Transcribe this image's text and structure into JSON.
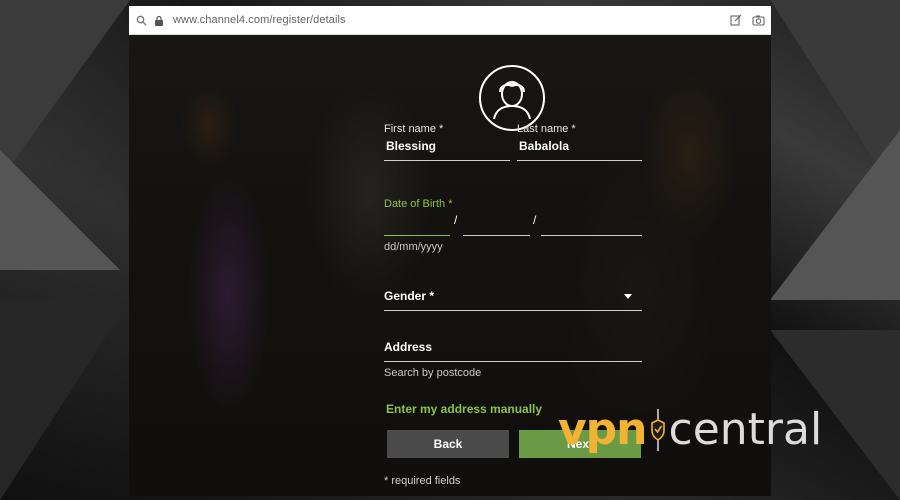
{
  "browser": {
    "url": "www.channel4.com/register/details"
  },
  "form": {
    "first_name_label": "First name *",
    "first_name_value": "Blessing",
    "last_name_label": "Last name *",
    "last_name_value": "Babalola",
    "dob_label": "Date of Birth *",
    "dob_separator": "/",
    "dob_hint": "dd/mm/yyyy",
    "gender_label": "Gender *",
    "address_label": "Address",
    "address_hint": "Search by postcode",
    "manual_address_link": "Enter my address manually",
    "back_button": "Back",
    "next_button": "Next",
    "required_note": "* required fields"
  },
  "watermark": {
    "brand_left": "vpn",
    "brand_right": "central"
  },
  "colors": {
    "accent_green": "#8bc34a",
    "button_green": "#6a9a46",
    "watermark_orange": "#f2b233"
  },
  "icons": [
    "search-icon",
    "lock-icon",
    "edit-icon",
    "camera-icon",
    "user-avatar-icon",
    "dropdown-caret-icon",
    "shield-icon"
  ]
}
